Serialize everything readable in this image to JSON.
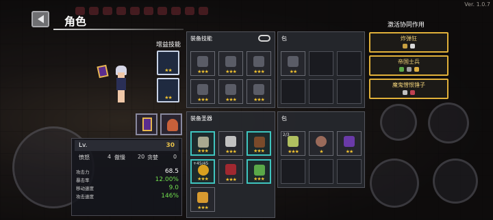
{
  "version": "Ver. 1.0.7",
  "header": {
    "title": "角色"
  },
  "bonus_skills": {
    "label": "增益技能",
    "slots": [
      {
        "stars": "★★"
      },
      {
        "stars": "★★"
      }
    ]
  },
  "stats": {
    "level_label": "Lv.",
    "level_value": "30",
    "traits": [
      {
        "name": "愤怒",
        "value": "4"
      },
      {
        "name": "傲慢",
        "value": "20"
      },
      {
        "name": "贪婪",
        "value": "0"
      }
    ],
    "rows": [
      {
        "label": "攻击力",
        "value": "68.5"
      },
      {
        "label": "暴击率",
        "value": "12.00%"
      },
      {
        "label": "移动速度",
        "value": "9.0"
      },
      {
        "label": "攻击速度",
        "value": "146%"
      }
    ]
  },
  "equip_skills": {
    "label": "装备技能",
    "slots": [
      {
        "stars": "★★★"
      },
      {
        "stars": "★★★"
      },
      {
        "stars": "★★★"
      },
      {
        "stars": "★★★"
      },
      {
        "stars": "★★★"
      },
      {
        "stars": "★★★"
      }
    ]
  },
  "skill_bag": {
    "label": "包",
    "slots": [
      {
        "stars": "★★"
      }
    ]
  },
  "equip_relics": {
    "label": "装备圣器",
    "slots": [
      {
        "stars": "★★★"
      },
      {
        "stars": "★★★"
      },
      {
        "stars": "★★★"
      },
      {
        "stars": "★★★",
        "counter": "+45/45"
      },
      {
        "stars": "★★★"
      },
      {
        "stars": "★★★"
      },
      {
        "stars": "★★★"
      }
    ]
  },
  "relic_bag": {
    "label": "包",
    "slots": [
      {
        "stars": "★★★",
        "counter": "2/3"
      },
      {
        "stars": "★"
      },
      {
        "stars": "★★"
      }
    ]
  },
  "synergy": {
    "title": "激活协同作用",
    "items": [
      {
        "name": "炸弹狂",
        "colors": [
          "#c8a040",
          "#d8d8d8"
        ]
      },
      {
        "name": "帝国士兵",
        "colors": [
          "#5aa848",
          "#a0a0a0",
          "#e0b040"
        ]
      },
      {
        "name": "魔鬼憎恨锤子",
        "colors": [
          "#c0c0c0",
          "#c04050"
        ]
      }
    ]
  },
  "colors": {
    "gold": "#e2b23a",
    "teal": "#3fc6c0",
    "star": "#f0c230",
    "green": "#72e04e"
  }
}
